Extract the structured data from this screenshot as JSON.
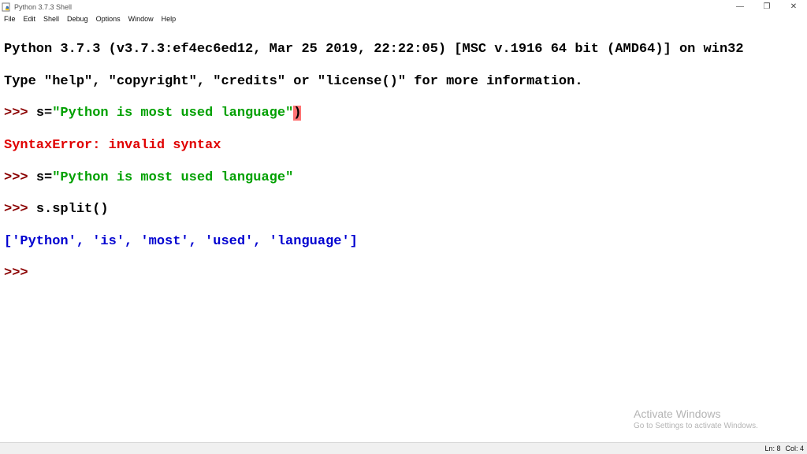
{
  "window": {
    "title": "Python 3.7.3 Shell",
    "icon": "python-idle-icon",
    "controls": {
      "minimize": "—",
      "restore": "❐",
      "close": "✕"
    }
  },
  "menubar": {
    "items": [
      "File",
      "Edit",
      "Shell",
      "Debug",
      "Options",
      "Window",
      "Help"
    ]
  },
  "shell": {
    "banner_line1": "Python 3.7.3 (v3.7.3:ef4ec6ed12, Mar 25 2019, 22:22:05) [MSC v.1916 64 bit (AMD64)] on win32",
    "banner_line2": "Type \"help\", \"copyright\", \"credits\" or \"license()\" for more information.",
    "prompt": ">>> ",
    "prompt_final": ">>>",
    "cmd1_prefix": "s=",
    "cmd1_string": "\"Python is most used language\"",
    "cmd1_error_char": ")",
    "error_text": "SyntaxError: invalid syntax",
    "cmd2_prefix": "s=",
    "cmd2_string": "\"Python is most used language\"",
    "cmd3": "s.split()",
    "output": "['Python', 'is', 'most', 'used', 'language']"
  },
  "watermark": {
    "title": "Activate Windows",
    "subtitle": "Go to Settings to activate Windows."
  },
  "statusbar": {
    "line": "Ln: 8",
    "col": "Col: 4"
  },
  "colors": {
    "prompt": "#8a0000",
    "string": "#00a000",
    "error": "#e00000",
    "output": "#0000d0",
    "error_highlight": "#ff7373"
  }
}
